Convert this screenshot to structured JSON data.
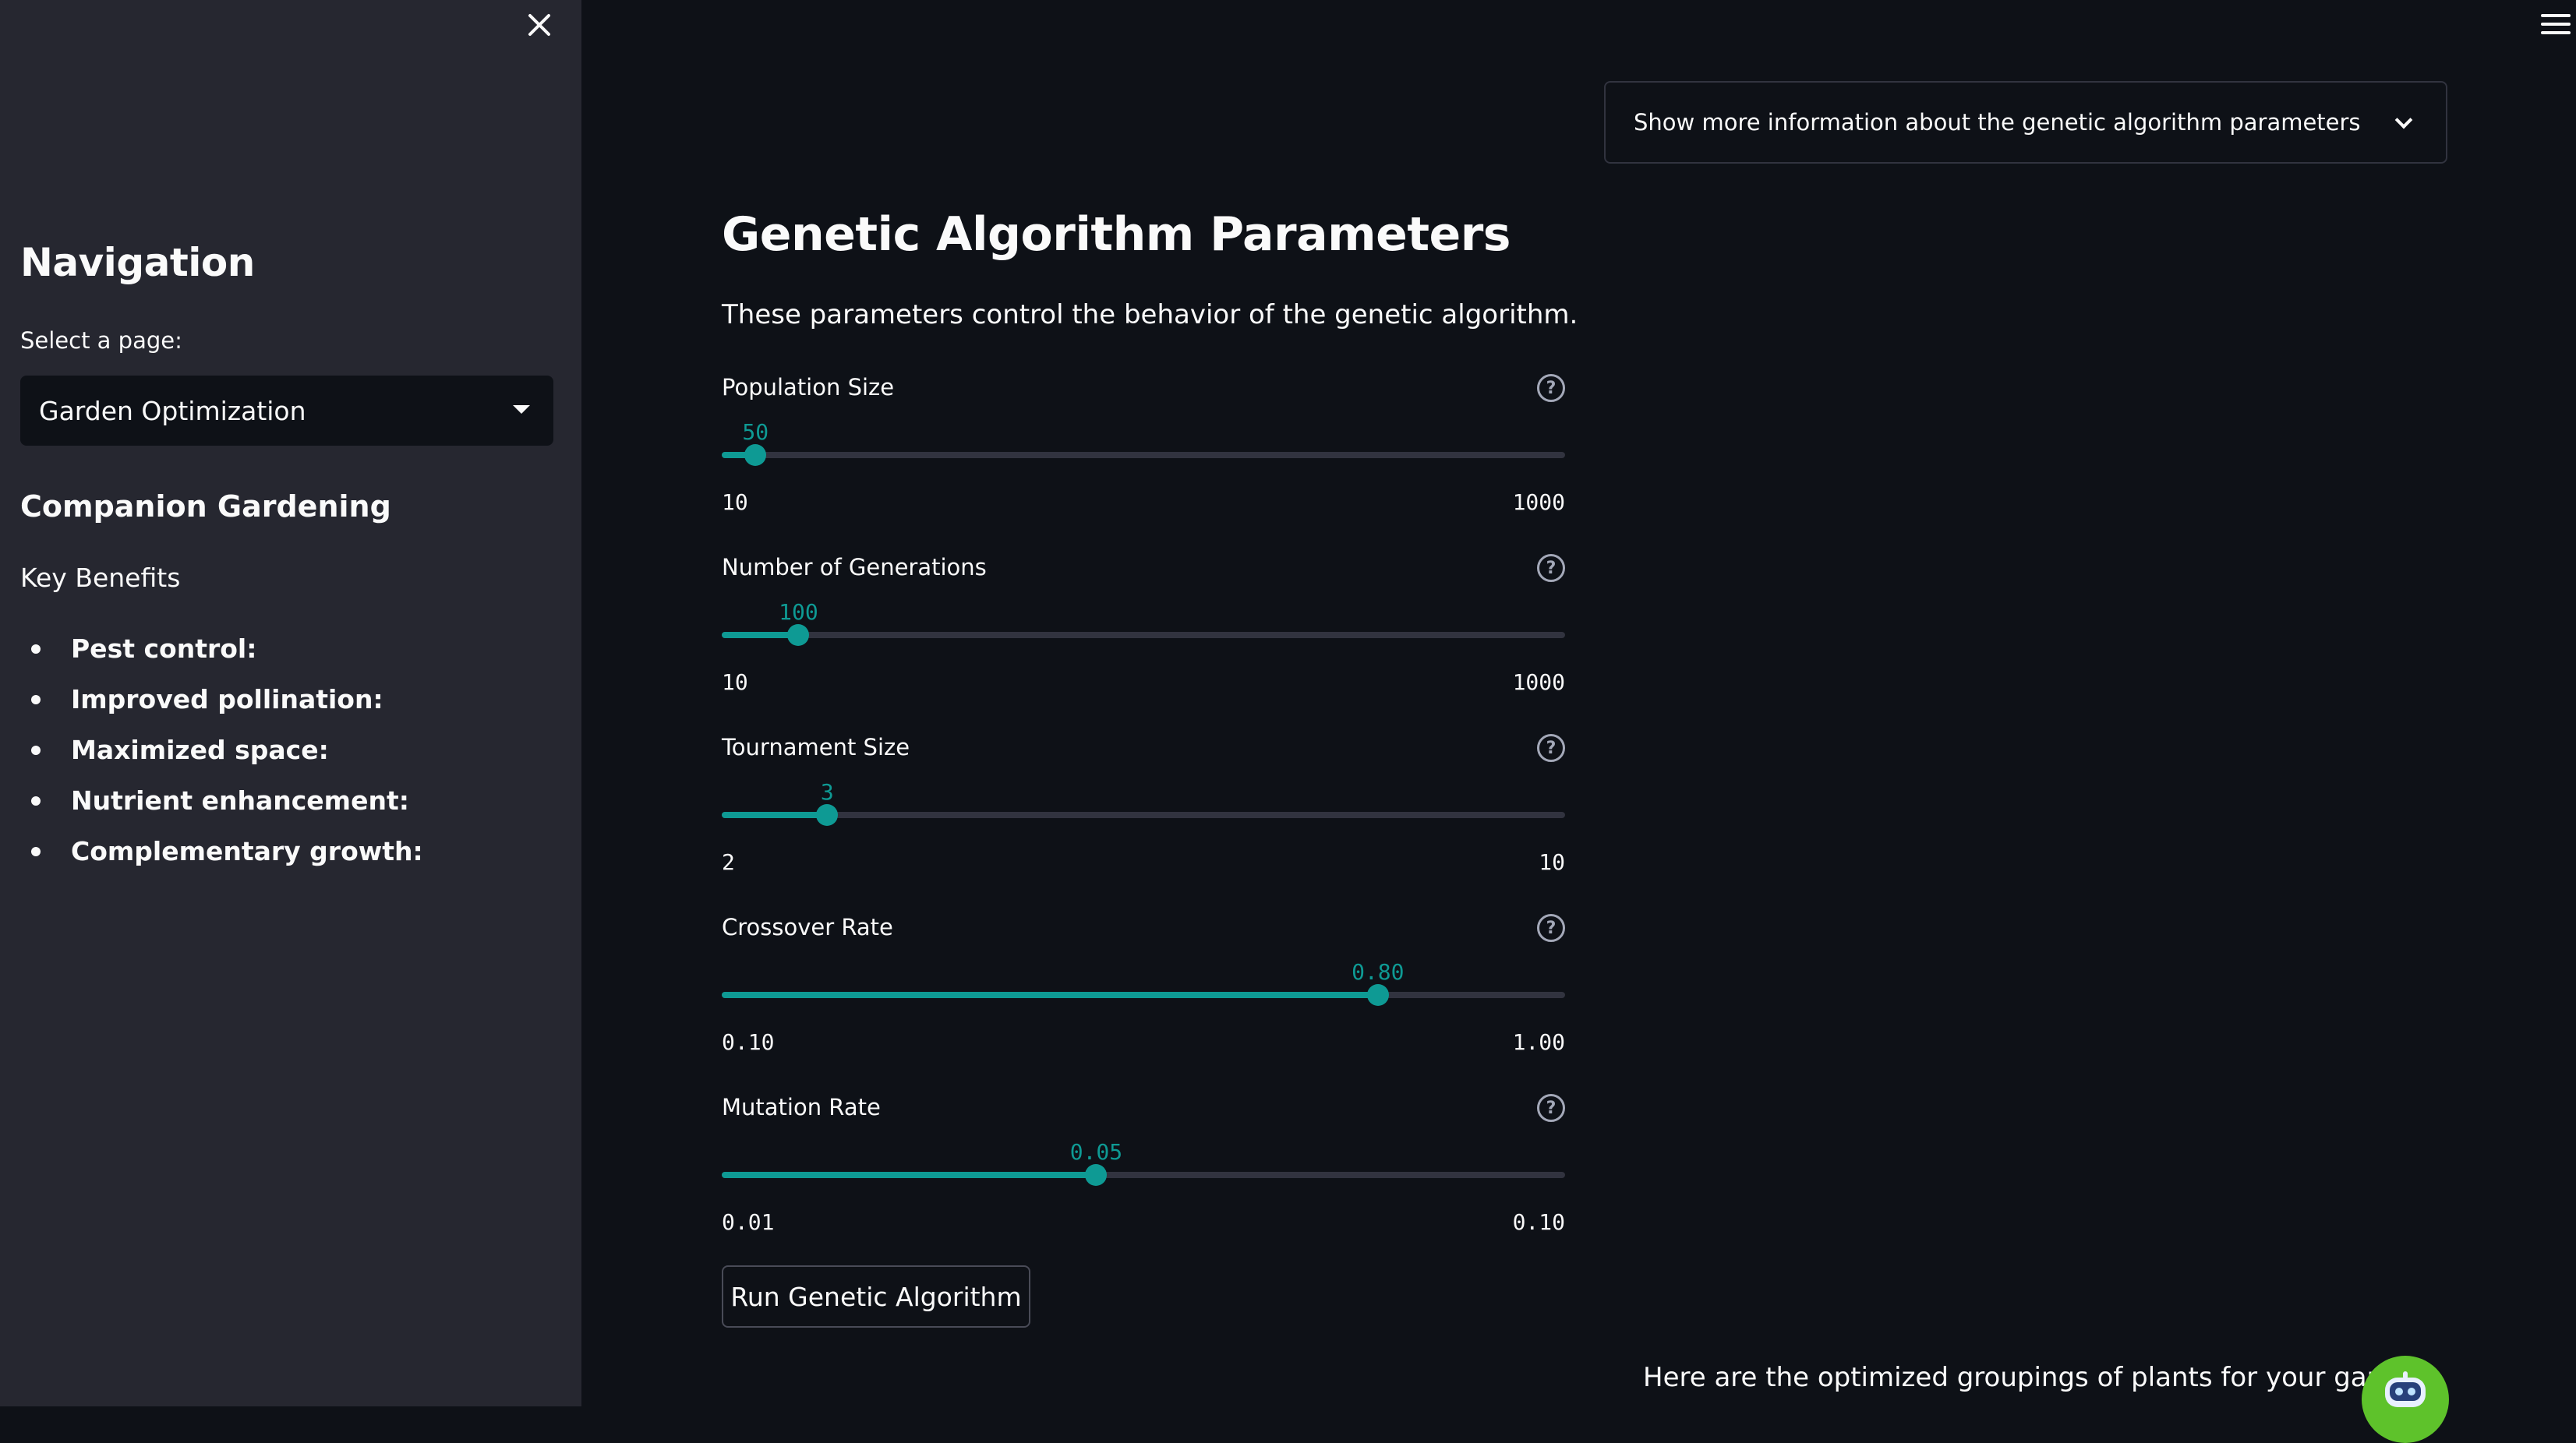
{
  "sidebar": {
    "navigation_title": "Navigation",
    "select_label": "Select a page:",
    "selected_page": "Garden Optimization",
    "section_title": "Companion Gardening",
    "subheading": "Key Benefits",
    "benefits": [
      "Pest control:",
      "Improved pollination:",
      "Maximized space:",
      "Nutrient enhancement:",
      "Complementary growth:"
    ]
  },
  "main": {
    "expander_label": "Show more information about the genetic algorithm parameters",
    "title": "Genetic Algorithm Parameters",
    "description": "These parameters control the behavior of the genetic algorithm.",
    "run_button": "Run Genetic Algorithm",
    "result_text": "Here are the optimized groupings of plants for your garden:"
  },
  "sliders": [
    {
      "label": "Population Size",
      "value": "50",
      "min": "10",
      "max": "1000",
      "fraction": 0.04
    },
    {
      "label": "Number of Generations",
      "value": "100",
      "min": "10",
      "max": "1000",
      "fraction": 0.091
    },
    {
      "label": "Tournament Size",
      "value": "3",
      "min": "2",
      "max": "10",
      "fraction": 0.125
    },
    {
      "label": "Crossover Rate",
      "value": "0.80",
      "min": "0.10",
      "max": "1.00",
      "fraction": 0.778
    },
    {
      "label": "Mutation Rate",
      "value": "0.05",
      "min": "0.01",
      "max": "0.10",
      "fraction": 0.444
    }
  ],
  "icons": {
    "close": "close-icon",
    "menu": "hamburger-menu-icon",
    "help": "question-circle-icon",
    "chevron": "chevron-down-icon",
    "avatar": "robot-avatar-icon"
  },
  "colors": {
    "accent": "#0e9a94",
    "sidebar_bg": "#262730",
    "main_bg": "#0e1117",
    "avatar_green": "#5ec22b"
  }
}
